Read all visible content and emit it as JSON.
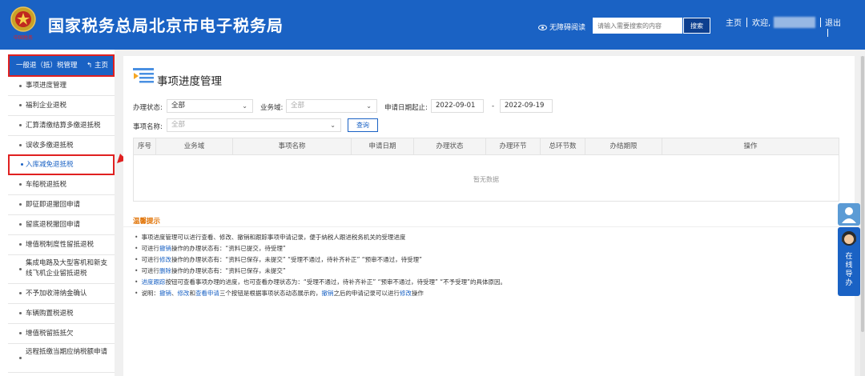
{
  "header": {
    "site_title": "国家税务总局北京市电子税务局",
    "accessibility": "无障碍阅读",
    "search_placeholder": "请输入需要搜索的内容",
    "search_button": "搜索",
    "home": "主页",
    "welcome": "欢迎,",
    "logout": "退出",
    "emblem_text": "中国税务"
  },
  "sidebar": {
    "section_title": "一般退（抵）税管理",
    "home_link": "主页",
    "items": [
      {
        "label": "事项进度管理"
      },
      {
        "label": "福利企业退税"
      },
      {
        "label": "汇算清缴结算多缴退抵税"
      },
      {
        "label": "误收多缴退抵税"
      },
      {
        "label": "入库减免退抵税"
      },
      {
        "label": "车船税退抵税"
      },
      {
        "label": "即征即退撤回申请"
      },
      {
        "label": "留底退税撤回申请"
      },
      {
        "label": "增值税制度性留抵退税"
      },
      {
        "label": "集成电路及大型客机和新支线飞机企业留抵退税"
      },
      {
        "label": "不予加收滞纳金确认"
      },
      {
        "label": "车辆购置税退税"
      },
      {
        "label": "增值税留抵抵欠"
      },
      {
        "label": "远程抵缴当期应纳税额申请"
      }
    ]
  },
  "main": {
    "title": "事项进度管理",
    "filters": {
      "status_label": "办理状态:",
      "status_value": "全部",
      "business_label": "业务域:",
      "business_value": "全部",
      "date_label": "申请日期起止:",
      "date_start": "2022-09-01",
      "date_sep": "-",
      "date_end": "2022-09-19",
      "item_label": "事项名称:",
      "item_value": "全部",
      "query_button": "查询"
    },
    "table": {
      "columns": [
        "序号",
        "业务域",
        "事项名称",
        "申请日期",
        "办理状态",
        "办理环节",
        "总环节数",
        "办结期限",
        "操作"
      ],
      "empty_text": "暂无数据"
    },
    "tips": {
      "title": "温馨提示",
      "lines": [
        {
          "parts": [
            {
              "t": "事项进度管理可以进行查看、修改、撤销和跟踪事项申请记录，便于纳税人跟进税务机关的受理进度"
            }
          ]
        },
        {
          "parts": [
            {
              "t": "可进行"
            },
            {
              "t": "撤销",
              "hl": true
            },
            {
              "t": "操作的办理状态有：“资料已提交，待受理”"
            }
          ]
        },
        {
          "parts": [
            {
              "t": "可进行"
            },
            {
              "t": "修改",
              "hl": true
            },
            {
              "t": "操作的办理状态有：“资料已保存，未提交”  “受理不通过，待补齐补正”  “预审不通过，待受理”"
            }
          ]
        },
        {
          "parts": [
            {
              "t": "可进行"
            },
            {
              "t": "删除",
              "hl": true
            },
            {
              "t": "操作的办理状态有：“资料已保存，未提交”"
            }
          ]
        },
        {
          "parts": [
            {
              "t": "进度跟踪",
              "hl": true
            },
            {
              "t": "按钮可查看事项办理的进度，也可查看办理状态为：“受理不通过，待补齐补正”  “预审不通过，待受理”  “不予受理”的具体原因。"
            }
          ]
        },
        {
          "parts": [
            {
              "t": "说明："
            },
            {
              "t": "撤销",
              "hl": true
            },
            {
              "t": "、"
            },
            {
              "t": "修改",
              "hl": true
            },
            {
              "t": "和"
            },
            {
              "t": "查看申请",
              "hl": true
            },
            {
              "t": "三个按钮是根据事项状态动态展示的，"
            },
            {
              "t": "撤销",
              "hl": true
            },
            {
              "t": "之后的申请记录可以进行"
            },
            {
              "t": "修改",
              "hl": true
            },
            {
              "t": "操作"
            }
          ]
        }
      ]
    }
  },
  "float": {
    "guide_text": "在线导办"
  },
  "colors": {
    "brand_blue": "#1a62c4",
    "highlight_red": "#e02020",
    "tips_orange": "#e07000"
  }
}
